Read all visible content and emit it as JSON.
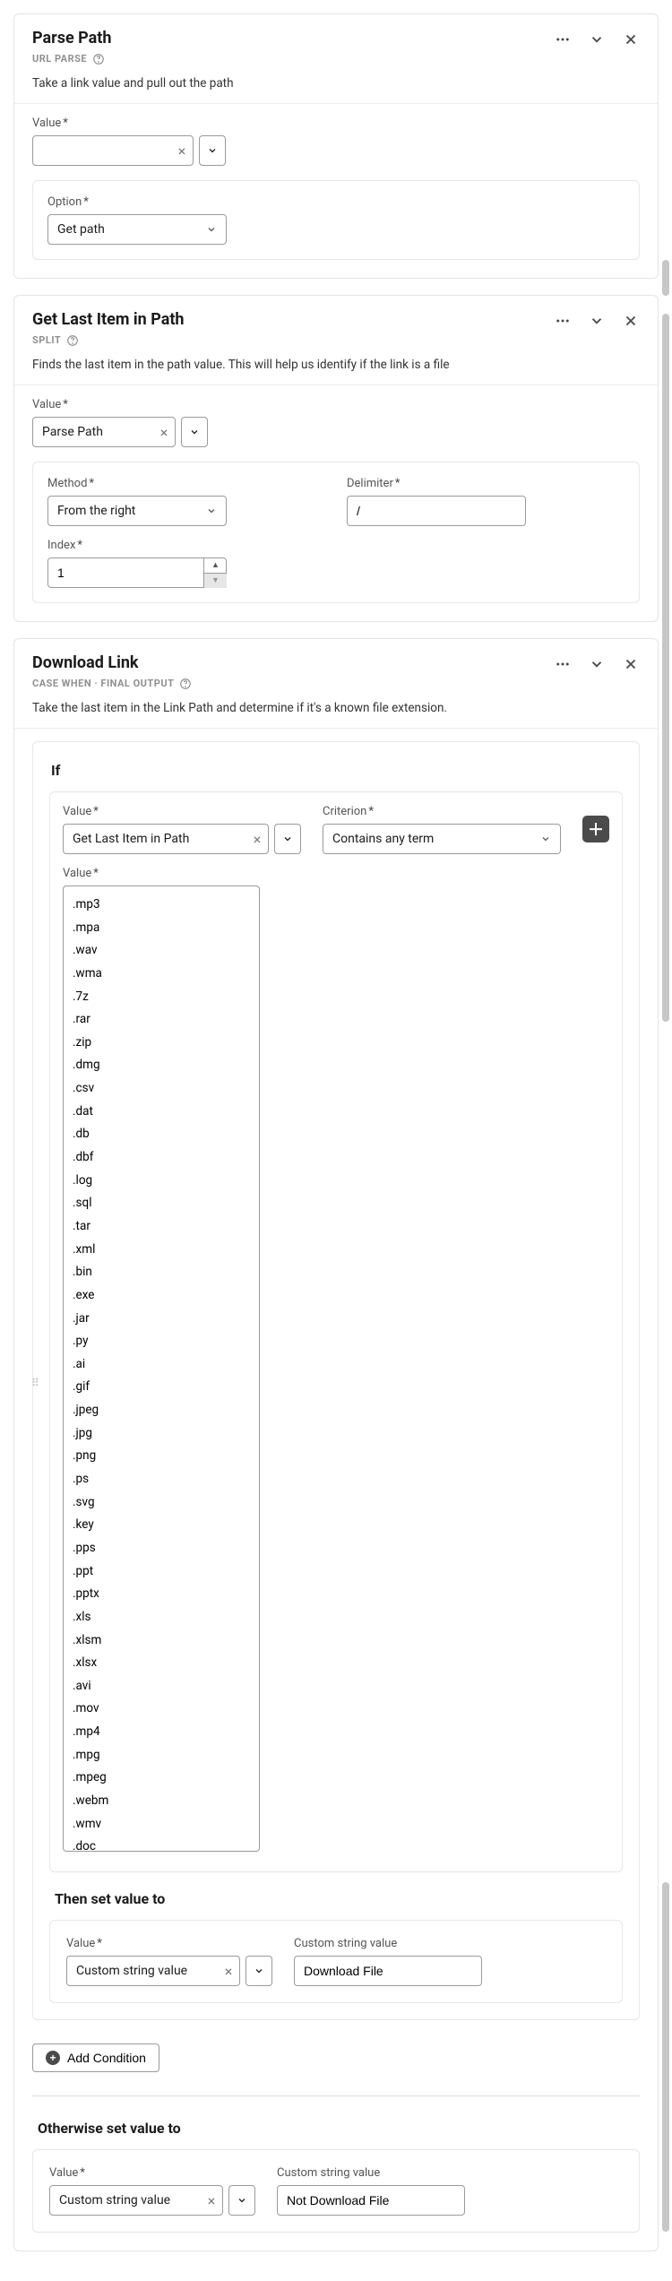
{
  "cards": [
    {
      "title": "Parse Path",
      "subtitle": "URL PARSE",
      "desc": "Take a link value and pull out the path",
      "value_label": "Value",
      "option_label": "Option",
      "option_value": "Get path"
    },
    {
      "title": "Get Last Item in Path",
      "subtitle": "SPLIT",
      "desc": "Finds the last item in the path value. This will help us identify if the link is a file",
      "value_label": "Value",
      "value_value": "Parse Path",
      "method_label": "Method",
      "method_value": "From the right",
      "delimiter_label": "Delimiter",
      "delimiter_value": "/",
      "index_label": "Index",
      "index_value": "1"
    },
    {
      "title": "Download Link",
      "subtitle": "CASE WHEN · FINAL OUTPUT",
      "desc": "Take the last item in the Link Path and determine if it's a known file extension.",
      "if_label": "If",
      "value_label": "Value",
      "criterion_label": "Criterion",
      "if_value": "Get Last Item in Path",
      "criterion_value": "Contains any term",
      "extensions_label": "Value",
      "extensions": ".mp3\n.mpa\n.wav\n.wma\n.7z\n.rar\n.zip\n.dmg\n.csv\n.dat\n.db\n.dbf\n.log\n.sql\n.tar\n.xml\n.bin\n.exe\n.jar\n.py\n.ai\n.gif\n.jpeg\n.jpg\n.png\n.ps\n.svg\n.key\n.pps\n.ppt\n.pptx\n.xls\n.xlsm\n.xlsx\n.avi\n.mov\n.mp4\n.mpg\n.mpeg\n.webm\n.wmv\n.doc\n.docx\n.pdf\n.rtf\n.tex\n.txt",
      "then_label": "Then set value to",
      "then_value_type": "Custom string value",
      "then_string_label": "Custom string value",
      "then_string_value": "Download File",
      "add_condition": "Add Condition",
      "else_label": "Otherwise set value to",
      "else_value_type": "Custom string value",
      "else_string_label": "Custom string value",
      "else_string_value": "Not Download File"
    }
  ]
}
